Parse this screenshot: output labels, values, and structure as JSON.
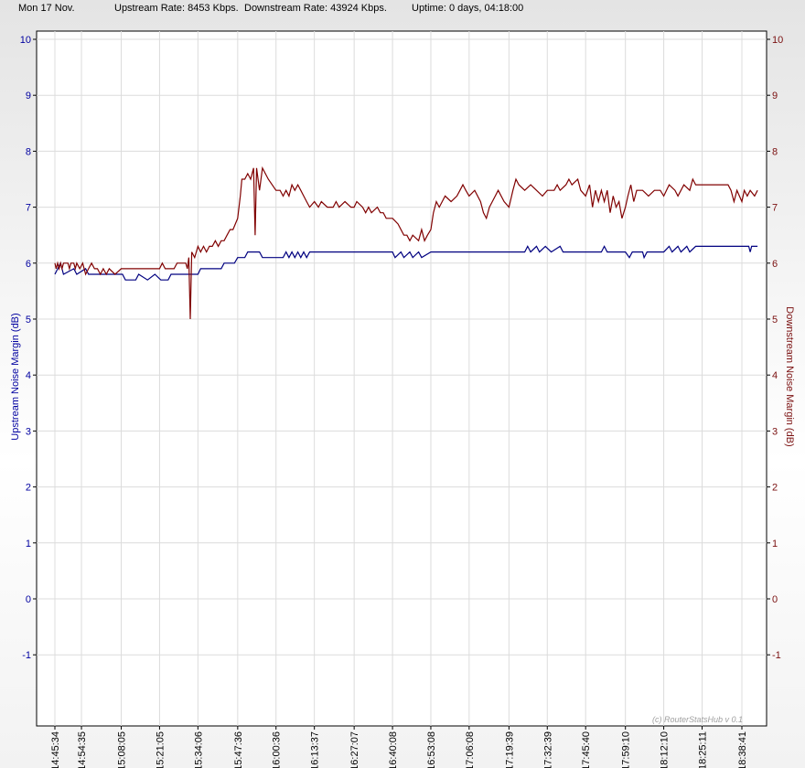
{
  "header": {
    "date": "Mon 17 Nov.",
    "upstream_rate": "Upstream Rate: 8453 Kbps.",
    "downstream_rate": "Downstream Rate: 43924 Kbps.",
    "uptime": "Uptime: 0 days, 04:18:00"
  },
  "credit": "(c) RouterStatsHub v 0.1",
  "colors": {
    "upstream": "#000080",
    "downstream": "#800000",
    "grid": "#dcdcdc"
  },
  "chart_data": {
    "type": "line",
    "ylabel": "Upstream Noise Margin (dB)",
    "y2label": "Downstream Noise Margin (dB)",
    "ylim": [
      -2,
      10.1
    ],
    "y_ticks": [
      -1,
      0,
      1,
      2,
      3,
      4,
      5,
      6,
      7,
      8,
      9,
      10
    ],
    "grid": true,
    "x_tick_labels": [
      "14:45:34",
      "14:54:35",
      "15:08:05",
      "15:21:05",
      "15:34:06",
      "15:47:36",
      "16:00:36",
      "16:13:37",
      "16:27:07",
      "16:40:08",
      "16:53:08",
      "17:06:08",
      "17:19:39",
      "17:32:39",
      "17:45:40",
      "17:59:10",
      "18:12:10",
      "18:25:11",
      "18:38:41"
    ],
    "series": [
      {
        "name": "Upstream Noise Margin (dB)",
        "axis": "left",
        "points": [
          [
            "14:45:34",
            5.8
          ],
          [
            "14:47:30",
            6.0
          ],
          [
            "14:48:30",
            5.8
          ],
          [
            "14:52:00",
            5.9
          ],
          [
            "14:53:00",
            5.8
          ],
          [
            "14:56:00",
            5.9
          ],
          [
            "14:57:00",
            5.8
          ],
          [
            "15:08:30",
            5.8
          ],
          [
            "15:09:30",
            5.7
          ],
          [
            "15:13:00",
            5.7
          ],
          [
            "15:14:00",
            5.8
          ],
          [
            "15:17:00",
            5.7
          ],
          [
            "15:19:30",
            5.8
          ],
          [
            "15:21:30",
            5.7
          ],
          [
            "15:24:00",
            5.7
          ],
          [
            "15:25:00",
            5.8
          ],
          [
            "15:34:06",
            5.8
          ],
          [
            "15:35:00",
            5.9
          ],
          [
            "15:42:00",
            5.9
          ],
          [
            "15:43:00",
            6.0
          ],
          [
            "15:46:30",
            6.0
          ],
          [
            "15:47:36",
            6.1
          ],
          [
            "15:50:00",
            6.1
          ],
          [
            "15:51:00",
            6.2
          ],
          [
            "15:55:00",
            6.2
          ],
          [
            "15:56:00",
            6.1
          ],
          [
            "16:03:00",
            6.1
          ],
          [
            "16:04:00",
            6.2
          ],
          [
            "16:05:00",
            6.1
          ],
          [
            "16:06:00",
            6.2
          ],
          [
            "16:07:00",
            6.1
          ],
          [
            "16:08:00",
            6.2
          ],
          [
            "16:09:00",
            6.1
          ],
          [
            "16:10:00",
            6.2
          ],
          [
            "16:11:00",
            6.1
          ],
          [
            "16:12:00",
            6.2
          ],
          [
            "16:13:37",
            6.2
          ],
          [
            "16:27:07",
            6.2
          ],
          [
            "16:40:08",
            6.2
          ],
          [
            "16:41:00",
            6.1
          ],
          [
            "16:43:00",
            6.2
          ],
          [
            "16:44:00",
            6.1
          ],
          [
            "16:46:00",
            6.2
          ],
          [
            "16:47:00",
            6.1
          ],
          [
            "16:49:00",
            6.2
          ],
          [
            "16:50:00",
            6.1
          ],
          [
            "16:53:08",
            6.2
          ],
          [
            "17:06:08",
            6.2
          ],
          [
            "17:19:39",
            6.2
          ],
          [
            "17:25:00",
            6.2
          ],
          [
            "17:26:00",
            6.3
          ],
          [
            "17:27:00",
            6.2
          ],
          [
            "17:29:00",
            6.3
          ],
          [
            "17:30:00",
            6.2
          ],
          [
            "17:32:00",
            6.3
          ],
          [
            "17:34:00",
            6.2
          ],
          [
            "17:37:00",
            6.3
          ],
          [
            "17:38:00",
            6.2
          ],
          [
            "17:45:40",
            6.2
          ],
          [
            "17:51:00",
            6.2
          ],
          [
            "17:52:00",
            6.3
          ],
          [
            "17:53:00",
            6.2
          ],
          [
            "17:59:10",
            6.2
          ],
          [
            "18:00:30",
            6.1
          ],
          [
            "18:01:30",
            6.2
          ],
          [
            "18:05:00",
            6.2
          ],
          [
            "18:05:30",
            6.1
          ],
          [
            "18:06:30",
            6.2
          ],
          [
            "18:12:10",
            6.2
          ],
          [
            "18:14:00",
            6.3
          ],
          [
            "18:15:00",
            6.2
          ],
          [
            "18:17:00",
            6.3
          ],
          [
            "18:18:00",
            6.2
          ],
          [
            "18:20:00",
            6.3
          ],
          [
            "18:21:00",
            6.2
          ],
          [
            "18:23:00",
            6.3
          ],
          [
            "18:25:11",
            6.3
          ],
          [
            "18:38:41",
            6.3
          ],
          [
            "18:41:00",
            6.3
          ],
          [
            "18:41:30",
            6.2
          ],
          [
            "18:42:00",
            6.3
          ],
          [
            "18:44:00",
            6.3
          ]
        ]
      },
      {
        "name": "Downstream Noise Margin (dB)",
        "axis": "right",
        "points": [
          [
            "14:45:34",
            6.0
          ],
          [
            "14:46:00",
            5.9
          ],
          [
            "14:46:30",
            6.0
          ],
          [
            "14:47:00",
            5.9
          ],
          [
            "14:47:30",
            6.0
          ],
          [
            "14:48:00",
            5.9
          ],
          [
            "14:48:30",
            6.0
          ],
          [
            "14:50:00",
            6.0
          ],
          [
            "14:50:30",
            5.9
          ],
          [
            "14:51:00",
            6.0
          ],
          [
            "14:52:00",
            6.0
          ],
          [
            "14:52:30",
            5.9
          ],
          [
            "14:53:00",
            6.0
          ],
          [
            "14:54:00",
            5.9
          ],
          [
            "14:55:00",
            6.0
          ],
          [
            "14:56:00",
            5.8
          ],
          [
            "14:57:00",
            5.9
          ],
          [
            "14:58:00",
            6.0
          ],
          [
            "14:59:00",
            5.9
          ],
          [
            "15:00:00",
            5.9
          ],
          [
            "15:01:00",
            5.8
          ],
          [
            "15:02:00",
            5.9
          ],
          [
            "15:03:00",
            5.8
          ],
          [
            "15:04:00",
            5.9
          ],
          [
            "15:06:00",
            5.8
          ],
          [
            "15:08:05",
            5.9
          ],
          [
            "15:12:00",
            5.9
          ],
          [
            "15:21:05",
            5.9
          ],
          [
            "15:22:00",
            6.0
          ],
          [
            "15:23:00",
            5.9
          ],
          [
            "15:26:00",
            5.9
          ],
          [
            "15:27:00",
            6.0
          ],
          [
            "15:30:00",
            6.0
          ],
          [
            "15:30:30",
            5.9
          ],
          [
            "15:31:00",
            6.1
          ],
          [
            "15:31:30",
            5.0
          ],
          [
            "15:32:00",
            6.2
          ],
          [
            "15:33:00",
            6.1
          ],
          [
            "15:34:06",
            6.3
          ],
          [
            "15:35:00",
            6.2
          ],
          [
            "15:36:00",
            6.3
          ],
          [
            "15:37:00",
            6.2
          ],
          [
            "15:38:00",
            6.3
          ],
          [
            "15:39:00",
            6.3
          ],
          [
            "15:40:00",
            6.4
          ],
          [
            "15:41:00",
            6.3
          ],
          [
            "15:42:00",
            6.4
          ],
          [
            "15:43:00",
            6.4
          ],
          [
            "15:44:00",
            6.5
          ],
          [
            "15:45:00",
            6.6
          ],
          [
            "15:46:00",
            6.6
          ],
          [
            "15:47:36",
            6.8
          ],
          [
            "15:48:30",
            7.2
          ],
          [
            "15:49:00",
            7.5
          ],
          [
            "15:50:00",
            7.5
          ],
          [
            "15:51:00",
            7.6
          ],
          [
            "15:52:00",
            7.5
          ],
          [
            "15:53:00",
            7.7
          ],
          [
            "15:53:30",
            6.5
          ],
          [
            "15:54:00",
            7.7
          ],
          [
            "15:55:00",
            7.3
          ],
          [
            "15:56:00",
            7.7
          ],
          [
            "15:57:00",
            7.6
          ],
          [
            "15:58:00",
            7.5
          ],
          [
            "16:00:36",
            7.3
          ],
          [
            "16:02:00",
            7.3
          ],
          [
            "16:03:00",
            7.2
          ],
          [
            "16:04:00",
            7.3
          ],
          [
            "16:05:00",
            7.2
          ],
          [
            "16:06:00",
            7.4
          ],
          [
            "16:07:00",
            7.3
          ],
          [
            "16:08:00",
            7.4
          ],
          [
            "16:09:00",
            7.3
          ],
          [
            "16:10:00",
            7.2
          ],
          [
            "16:11:00",
            7.1
          ],
          [
            "16:12:00",
            7.0
          ],
          [
            "16:13:37",
            7.1
          ],
          [
            "16:15:00",
            7.0
          ],
          [
            "16:16:00",
            7.1
          ],
          [
            "16:18:00",
            7.0
          ],
          [
            "16:20:00",
            7.0
          ],
          [
            "16:21:00",
            7.1
          ],
          [
            "16:22:00",
            7.0
          ],
          [
            "16:24:00",
            7.1
          ],
          [
            "16:26:00",
            7.0
          ],
          [
            "16:27:07",
            7.0
          ],
          [
            "16:28:00",
            7.1
          ],
          [
            "16:30:00",
            7.0
          ],
          [
            "16:31:00",
            6.9
          ],
          [
            "16:32:00",
            7.0
          ],
          [
            "16:33:00",
            6.9
          ],
          [
            "16:35:00",
            7.0
          ],
          [
            "16:36:00",
            6.9
          ],
          [
            "16:37:00",
            6.9
          ],
          [
            "16:38:00",
            6.8
          ],
          [
            "16:40:08",
            6.8
          ],
          [
            "16:42:00",
            6.7
          ],
          [
            "16:44:00",
            6.5
          ],
          [
            "16:45:00",
            6.5
          ],
          [
            "16:46:00",
            6.4
          ],
          [
            "16:47:00",
            6.5
          ],
          [
            "16:49:00",
            6.4
          ],
          [
            "16:50:00",
            6.6
          ],
          [
            "16:51:00",
            6.4
          ],
          [
            "16:52:00",
            6.5
          ],
          [
            "16:53:08",
            6.6
          ],
          [
            "16:54:00",
            6.9
          ],
          [
            "16:55:00",
            7.1
          ],
          [
            "16:56:00",
            7.0
          ],
          [
            "16:58:00",
            7.2
          ],
          [
            "17:00:00",
            7.1
          ],
          [
            "17:02:00",
            7.2
          ],
          [
            "17:03:00",
            7.3
          ],
          [
            "17:04:00",
            7.4
          ],
          [
            "17:05:00",
            7.3
          ],
          [
            "17:06:08",
            7.2
          ],
          [
            "17:08:00",
            7.3
          ],
          [
            "17:10:00",
            7.1
          ],
          [
            "17:11:00",
            6.9
          ],
          [
            "17:12:00",
            6.8
          ],
          [
            "17:13:00",
            7.0
          ],
          [
            "17:14:00",
            7.1
          ],
          [
            "17:15:00",
            7.2
          ],
          [
            "17:16:00",
            7.3
          ],
          [
            "17:18:00",
            7.1
          ],
          [
            "17:19:39",
            7.0
          ],
          [
            "17:21:00",
            7.3
          ],
          [
            "17:22:00",
            7.5
          ],
          [
            "17:23:00",
            7.4
          ],
          [
            "17:25:00",
            7.3
          ],
          [
            "17:27:00",
            7.4
          ],
          [
            "17:29:00",
            7.3
          ],
          [
            "17:31:00",
            7.2
          ],
          [
            "17:32:39",
            7.3
          ],
          [
            "17:35:00",
            7.3
          ],
          [
            "17:36:00",
            7.4
          ],
          [
            "17:37:00",
            7.3
          ],
          [
            "17:39:00",
            7.4
          ],
          [
            "17:40:00",
            7.5
          ],
          [
            "17:41:00",
            7.4
          ],
          [
            "17:43:00",
            7.5
          ],
          [
            "17:44:00",
            7.3
          ],
          [
            "17:45:40",
            7.2
          ],
          [
            "17:47:00",
            7.4
          ],
          [
            "17:48:00",
            7.0
          ],
          [
            "17:49:00",
            7.3
          ],
          [
            "17:50:00",
            7.1
          ],
          [
            "17:51:00",
            7.3
          ],
          [
            "17:52:00",
            7.1
          ],
          [
            "17:53:00",
            7.3
          ],
          [
            "17:54:00",
            6.9
          ],
          [
            "17:55:00",
            7.2
          ],
          [
            "17:56:00",
            7.0
          ],
          [
            "17:57:00",
            7.1
          ],
          [
            "17:58:00",
            6.8
          ],
          [
            "17:59:10",
            7.0
          ],
          [
            "18:00:00",
            7.2
          ],
          [
            "18:01:00",
            7.4
          ],
          [
            "18:02:00",
            7.1
          ],
          [
            "18:03:00",
            7.3
          ],
          [
            "18:05:00",
            7.3
          ],
          [
            "18:07:00",
            7.2
          ],
          [
            "18:09:00",
            7.3
          ],
          [
            "18:11:00",
            7.3
          ],
          [
            "18:12:10",
            7.2
          ],
          [
            "18:14:00",
            7.4
          ],
          [
            "18:16:00",
            7.3
          ],
          [
            "18:17:00",
            7.2
          ],
          [
            "18:19:00",
            7.4
          ],
          [
            "18:21:00",
            7.3
          ],
          [
            "18:22:00",
            7.5
          ],
          [
            "18:23:00",
            7.4
          ],
          [
            "18:25:11",
            7.4
          ],
          [
            "18:28:00",
            7.4
          ],
          [
            "18:31:00",
            7.4
          ],
          [
            "18:34:00",
            7.4
          ],
          [
            "18:35:00",
            7.3
          ],
          [
            "18:36:00",
            7.1
          ],
          [
            "18:37:00",
            7.3
          ],
          [
            "18:38:41",
            7.1
          ],
          [
            "18:39:30",
            7.3
          ],
          [
            "18:40:30",
            7.2
          ],
          [
            "18:41:30",
            7.3
          ],
          [
            "18:43:00",
            7.2
          ],
          [
            "18:44:00",
            7.3
          ]
        ]
      }
    ]
  }
}
